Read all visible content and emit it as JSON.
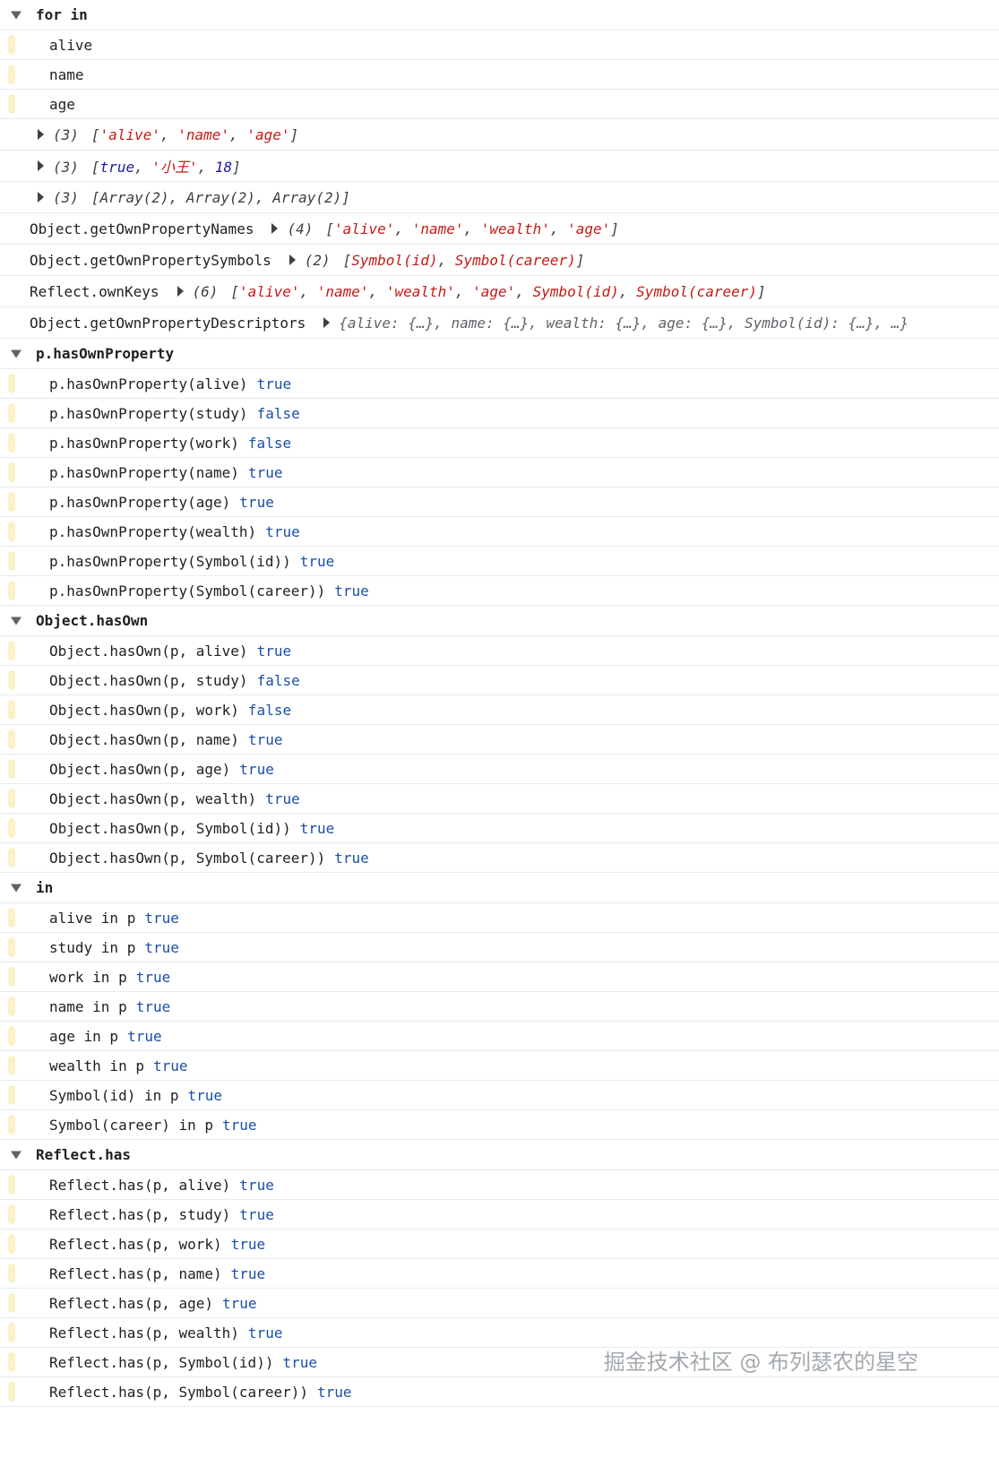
{
  "forin": {
    "title": "for in",
    "items": [
      "alive",
      "name",
      "age"
    ],
    "arrays": [
      {
        "count": "(3)",
        "open": "[",
        "parts": [
          [
            "str",
            "'alive'"
          ],
          [
            "p",
            ", "
          ],
          [
            "str",
            "'name'"
          ],
          [
            "p",
            ", "
          ],
          [
            "str",
            "'age'"
          ]
        ],
        "close": "]"
      },
      {
        "count": "(3)",
        "open": "[",
        "parts": [
          [
            "kw",
            "true"
          ],
          [
            "p",
            ", "
          ],
          [
            "str",
            "'小王'"
          ],
          [
            "p",
            ", "
          ],
          [
            "num",
            "18"
          ]
        ],
        "close": "]"
      },
      {
        "count": "(3)",
        "open": "[",
        "parts": [
          [
            "p",
            "Array(2), Array(2), Array(2)"
          ]
        ],
        "close": "]"
      }
    ]
  },
  "props": [
    {
      "label": "Object.getOwnPropertyNames",
      "count": "(4)",
      "open": "[",
      "parts": [
        [
          "str",
          "'alive'"
        ],
        [
          "p",
          ", "
        ],
        [
          "str",
          "'name'"
        ],
        [
          "p",
          ", "
        ],
        [
          "str",
          "'wealth'"
        ],
        [
          "p",
          ", "
        ],
        [
          "str",
          "'age'"
        ]
      ],
      "close": "]"
    },
    {
      "label": "Object.getOwnPropertySymbols",
      "count": "(2)",
      "open": "[",
      "parts": [
        [
          "str",
          "Symbol(id)"
        ],
        [
          "p",
          ", "
        ],
        [
          "str",
          "Symbol(career)"
        ]
      ],
      "close": "]"
    },
    {
      "label": "Reflect.ownKeys",
      "count": "(6)",
      "open": "[",
      "parts": [
        [
          "str",
          "'alive'"
        ],
        [
          "p",
          ", "
        ],
        [
          "str",
          "'name'"
        ],
        [
          "p",
          ", "
        ],
        [
          "str",
          "'wealth'"
        ],
        [
          "p",
          ", "
        ],
        [
          "str",
          "'age'"
        ],
        [
          "p",
          ", "
        ],
        [
          "str",
          "Symbol(id)"
        ],
        [
          "p",
          ", "
        ],
        [
          "str",
          "Symbol(career)"
        ]
      ],
      "close": "]"
    },
    {
      "label": "Object.getOwnPropertyDescriptors",
      "count": "",
      "open": "",
      "parts": [
        [
          "g",
          "{alive: {…}, name: {…}, wealth: {…}, age: {…}, Symbol(id): {…},  …}"
        ]
      ],
      "close": ""
    }
  ],
  "groups": [
    {
      "title": "p.hasOwnProperty",
      "rows": [
        {
          "expr": "p.hasOwnProperty(alive)",
          "value": "true"
        },
        {
          "expr": "p.hasOwnProperty(study)",
          "value": "false"
        },
        {
          "expr": "p.hasOwnProperty(work)",
          "value": "false"
        },
        {
          "expr": "p.hasOwnProperty(name)",
          "value": "true"
        },
        {
          "expr": "p.hasOwnProperty(age)",
          "value": "true"
        },
        {
          "expr": "p.hasOwnProperty(wealth)",
          "value": "true"
        },
        {
          "expr": "p.hasOwnProperty(Symbol(id))",
          "value": "true"
        },
        {
          "expr": "p.hasOwnProperty(Symbol(career))",
          "value": "true"
        }
      ]
    },
    {
      "title": "Object.hasOwn",
      "rows": [
        {
          "expr": "Object.hasOwn(p, alive)",
          "value": "true"
        },
        {
          "expr": "Object.hasOwn(p, study)",
          "value": "false"
        },
        {
          "expr": "Object.hasOwn(p, work)",
          "value": "false"
        },
        {
          "expr": "Object.hasOwn(p, name)",
          "value": "true"
        },
        {
          "expr": "Object.hasOwn(p, age)",
          "value": "true"
        },
        {
          "expr": "Object.hasOwn(p, wealth)",
          "value": "true"
        },
        {
          "expr": "Object.hasOwn(p, Symbol(id))",
          "value": "true"
        },
        {
          "expr": "Object.hasOwn(p, Symbol(career))",
          "value": "true"
        }
      ]
    },
    {
      "title": "in",
      "rows": [
        {
          "expr": "alive in p",
          "value": "true"
        },
        {
          "expr": "study in p",
          "value": "true"
        },
        {
          "expr": "work in p",
          "value": "true"
        },
        {
          "expr": "name in p",
          "value": "true"
        },
        {
          "expr": "age in p",
          "value": "true"
        },
        {
          "expr": "wealth in p",
          "value": "true"
        },
        {
          "expr": "Symbol(id) in p",
          "value": "true"
        },
        {
          "expr": "Symbol(career) in p",
          "value": "true"
        }
      ]
    },
    {
      "title": "Reflect.has",
      "rows": [
        {
          "expr": "Reflect.has(p, alive)",
          "value": "true"
        },
        {
          "expr": "Reflect.has(p, study)",
          "value": "true"
        },
        {
          "expr": "Reflect.has(p, work)",
          "value": "true"
        },
        {
          "expr": "Reflect.has(p, name)",
          "value": "true"
        },
        {
          "expr": "Reflect.has(p, age)",
          "value": "true"
        },
        {
          "expr": "Reflect.has(p, wealth)",
          "value": "true"
        },
        {
          "expr": "Reflect.has(p, Symbol(id))",
          "value": "true"
        },
        {
          "expr": "Reflect.has(p, Symbol(career))",
          "value": "true"
        }
      ]
    }
  ],
  "watermark": "掘金技术社区 @ 布列瑟农的星空"
}
